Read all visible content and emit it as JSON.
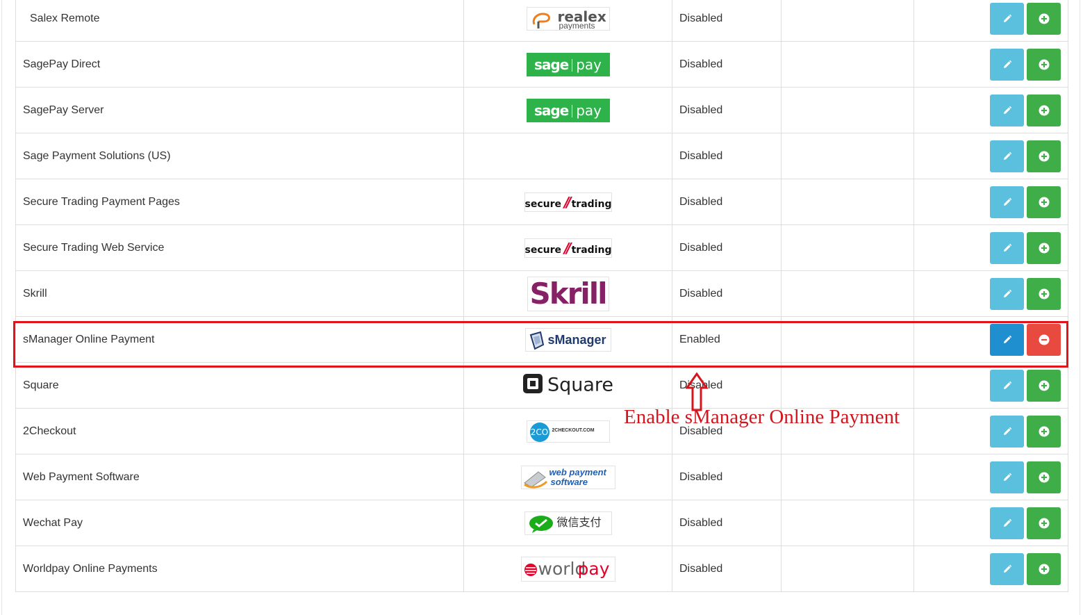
{
  "rows": [
    {
      "name": "Salex Remote",
      "logo": "realex",
      "logo_text": "realex",
      "logo_sub": "payments",
      "status": "Disabled",
      "enabled": false,
      "edit_icon": "pencil-icon",
      "toggle_icon": "plus-circle-icon"
    },
    {
      "name": "SagePay Direct",
      "logo": "sagepay",
      "logo_text": "sage",
      "logo_sub": "pay",
      "status": "Disabled",
      "enabled": false,
      "edit_icon": "pencil-icon",
      "toggle_icon": "plus-circle-icon"
    },
    {
      "name": "SagePay Server",
      "logo": "sagepay",
      "logo_text": "sage",
      "logo_sub": "pay",
      "status": "Disabled",
      "enabled": false,
      "edit_icon": "pencil-icon",
      "toggle_icon": "plus-circle-icon"
    },
    {
      "name": "Sage Payment Solutions (US)",
      "logo": "none",
      "status": "Disabled",
      "enabled": false,
      "edit_icon": "pencil-icon",
      "toggle_icon": "plus-circle-icon"
    },
    {
      "name": "Secure Trading Payment Pages",
      "logo": "securetrading",
      "logo_text": "secure",
      "logo_sub": "trading",
      "status": "Disabled",
      "enabled": false,
      "edit_icon": "pencil-icon",
      "toggle_icon": "plus-circle-icon"
    },
    {
      "name": "Secure Trading Web Service",
      "logo": "securetrading",
      "logo_text": "secure",
      "logo_sub": "trading",
      "status": "Disabled",
      "enabled": false,
      "edit_icon": "pencil-icon",
      "toggle_icon": "plus-circle-icon"
    },
    {
      "name": "Skrill",
      "logo": "skrill",
      "logo_text": "Skrill",
      "status": "Disabled",
      "enabled": false,
      "edit_icon": "pencil-icon",
      "toggle_icon": "plus-circle-icon"
    },
    {
      "name": "sManager Online Payment",
      "logo": "smanager",
      "logo_text": "sManager",
      "status": "Enabled",
      "enabled": true,
      "edit_icon": "pencil-icon",
      "toggle_icon": "minus-circle-icon"
    },
    {
      "name": "Square",
      "logo": "square",
      "logo_text": "Square",
      "status": "Disabled",
      "enabled": false,
      "edit_icon": "pencil-icon",
      "toggle_icon": "plus-circle-icon"
    },
    {
      "name": "2Checkout",
      "logo": "2checkout",
      "logo_text": "2CO",
      "logo_sub": "2CHECKOUT.COM",
      "status": "Disabled",
      "enabled": false,
      "edit_icon": "pencil-icon",
      "toggle_icon": "plus-circle-icon"
    },
    {
      "name": "Web Payment Software",
      "logo": "webpaymentsoftware",
      "logo_text": "web payment",
      "logo_sub": "software",
      "status": "Disabled",
      "enabled": false,
      "edit_icon": "pencil-icon",
      "toggle_icon": "plus-circle-icon"
    },
    {
      "name": "Wechat Pay",
      "logo": "wechat",
      "logo_text": "微信支付",
      "status": "Disabled",
      "enabled": false,
      "edit_icon": "pencil-icon",
      "toggle_icon": "plus-circle-icon"
    },
    {
      "name": "Worldpay Online Payments",
      "logo": "worldpay",
      "logo_text": "world",
      "logo_sub": "pay",
      "status": "Disabled",
      "enabled": false,
      "edit_icon": "pencil-icon",
      "toggle_icon": "plus-circle-icon"
    }
  ],
  "annotation": {
    "text": "Enable sManager Online Payment",
    "color": "#d4151d",
    "icon": "arrow-up-outline-icon"
  },
  "colors": {
    "edit_button": "#5bc0de",
    "edit_button_active": "#1f8fd0",
    "install_button": "#3fae49",
    "uninstall_button": "#e84a3f",
    "highlight": "#e1141c"
  }
}
